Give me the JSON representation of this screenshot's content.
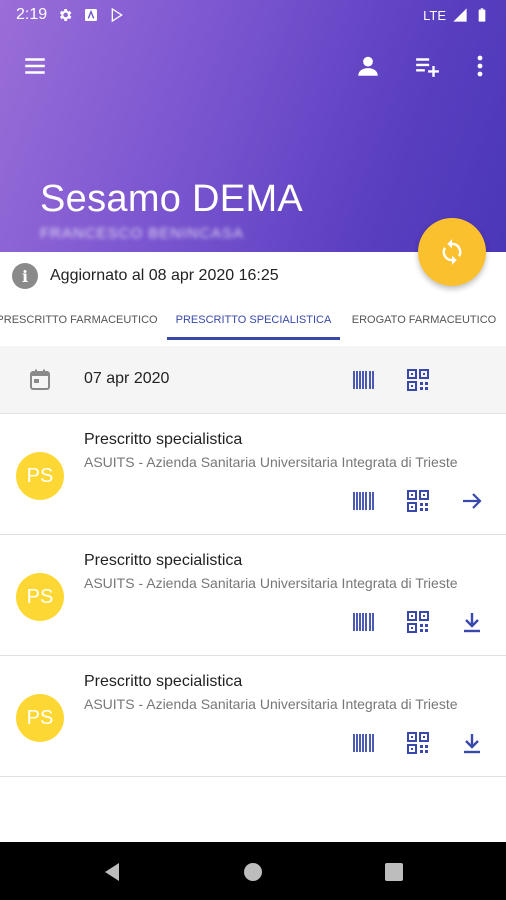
{
  "status_bar": {
    "time": "2:19",
    "network": "LTE"
  },
  "header": {
    "title": "Sesamo DEMA",
    "subtitle": "FRANCESCO BENINCASA",
    "refresh_label": "Aggiorna"
  },
  "updated": {
    "text": "Aggiornato al 08 apr 2020 16:25"
  },
  "tabs": [
    {
      "label": "Prescritto farmaceutico",
      "active": false
    },
    {
      "label": "Prescritto specialistica",
      "active": true
    },
    {
      "label": "Erogato farmaceutico",
      "active": false
    }
  ],
  "date_bar": {
    "date": "07 apr 2020"
  },
  "items": [
    {
      "avatar": "PS",
      "title": "Prescritto specialistica",
      "subtitle": "ASUITS - Azienda Sanitaria Universitaria Integrata di Trieste",
      "action_icon": "arrow-forward-icon"
    },
    {
      "avatar": "PS",
      "title": "Prescritto specialistica",
      "subtitle": "ASUITS - Azienda Sanitaria Universitaria Integrata di Trieste",
      "action_icon": "download-icon"
    },
    {
      "avatar": "PS",
      "title": "Prescritto specialistica",
      "subtitle": "ASUITS - Azienda Sanitaria Universitaria Integrata di Trieste",
      "action_icon": "download-icon"
    }
  ],
  "colors": {
    "accent": "#3949ab",
    "fab": "#fbc02d",
    "avatar": "#fdd835",
    "header_gradient": [
      "#9a6ed8",
      "#4a37b8"
    ]
  }
}
